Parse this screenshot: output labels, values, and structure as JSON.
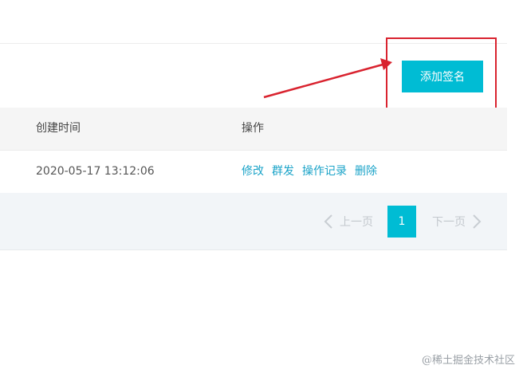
{
  "toolbar": {
    "add_signature_label": "添加签名"
  },
  "table": {
    "columns": [
      "创建时间",
      "操作"
    ],
    "rows": [
      {
        "created_at": "2020-05-17 13:12:06",
        "actions": [
          "修改",
          "群发",
          "操作记录",
          "删除"
        ]
      }
    ]
  },
  "pagination": {
    "prev_label": "上一页",
    "current_page": "1",
    "next_label": "下一页"
  },
  "watermark": "@稀土掘金技术社区",
  "colors": {
    "accent": "#00bcd4",
    "link": "#1aa3c8",
    "annotation_red": "#d9232f"
  }
}
